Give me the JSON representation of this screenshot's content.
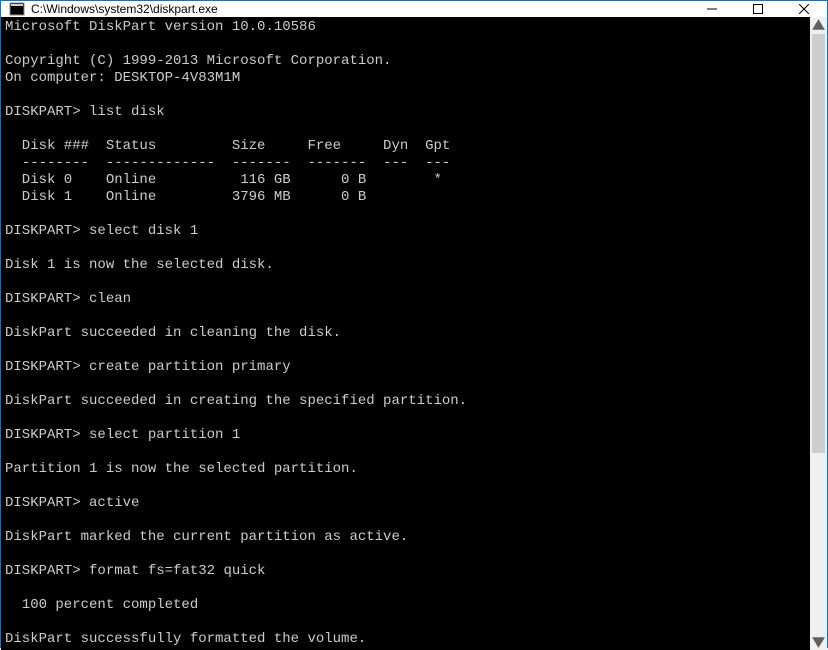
{
  "window": {
    "title": "C:\\Windows\\system32\\diskpart.exe"
  },
  "console": {
    "header_line": "Microsoft DiskPart version 10.0.10586",
    "copyright_line": "Copyright (C) 1999-2013 Microsoft Corporation.",
    "computer_line": "On computer: DESKTOP-4V83M1M",
    "prompt": "DISKPART>",
    "commands": {
      "c1": "list disk",
      "c2": "select disk 1",
      "c3": "clean",
      "c4": "create partition primary",
      "c5": "select partition 1",
      "c6": "active",
      "c7": "format fs=fat32 quick"
    },
    "disk_table": {
      "header": "  Disk ###  Status         Size     Free     Dyn  Gpt",
      "divider": "  --------  -------------  -------  -------  ---  ---",
      "row0": "  Disk 0    Online          116 GB      0 B        *",
      "row1": "  Disk 1    Online         3796 MB      0 B"
    },
    "responses": {
      "r2": "Disk 1 is now the selected disk.",
      "r3": "DiskPart succeeded in cleaning the disk.",
      "r4": "DiskPart succeeded in creating the specified partition.",
      "r5": "Partition 1 is now the selected partition.",
      "r6": "DiskPart marked the current partition as active.",
      "r7a": "  100 percent completed",
      "r7b": "DiskPart successfully formatted the volume."
    }
  }
}
